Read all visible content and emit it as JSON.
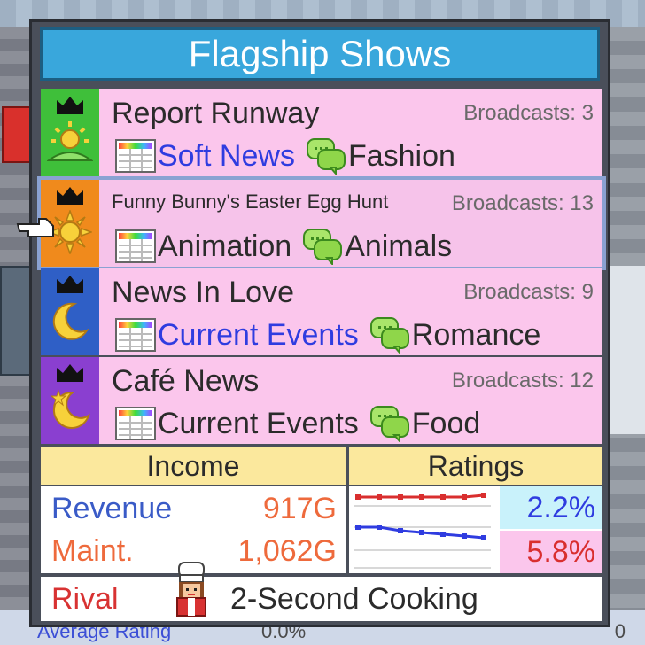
{
  "panel": {
    "title": "Flagship Shows"
  },
  "shows": [
    {
      "title": "Report Runway",
      "broadcasts": "Broadcasts: 3",
      "genre": "Soft News",
      "topic": "Fashion",
      "icon": "sun-hill-icon",
      "icon_bg": "#3fbf3a"
    },
    {
      "title": "Funny Bunny's Easter Egg Hunt",
      "broadcasts": "Broadcasts: 13",
      "genre": "Animation",
      "topic": "Animals",
      "icon": "sun-icon",
      "icon_bg": "#f08a1c"
    },
    {
      "title": "News In Love",
      "broadcasts": "Broadcasts: 9",
      "genre": "Current Events",
      "topic": "Romance",
      "icon": "moon-icon",
      "icon_bg": "#2f5fc6"
    },
    {
      "title": "Café News",
      "broadcasts": "Broadcasts: 12",
      "genre": "Current Events",
      "topic": "Food",
      "icon": "moon-star-icon",
      "icon_bg": "#8a3fd0"
    }
  ],
  "income": {
    "header": "Income",
    "revenue_label": "Revenue",
    "revenue_value": "917G",
    "maint_label": "Maint.",
    "maint_value": "1,062G"
  },
  "ratings": {
    "header": "Ratings",
    "top_value": "2.2%",
    "bottom_value": "5.8%"
  },
  "rival": {
    "label": "Rival",
    "name": "2-Second Cooking"
  },
  "background": {
    "partial_label": "Average Rating",
    "partial_value": "0.0%",
    "partial_right": "0"
  },
  "colors": {
    "title_bar": "#39a7dc",
    "row_bg": "#fbc6ec",
    "header_bg": "#fbe89d",
    "revenue_label": "#3a5bc7",
    "maint_label": "#ee6a3c",
    "rival_label": "#d83232",
    "rating_top_bg": "#c9f2fb",
    "rating_bottom_bg": "#fbc6ec"
  }
}
